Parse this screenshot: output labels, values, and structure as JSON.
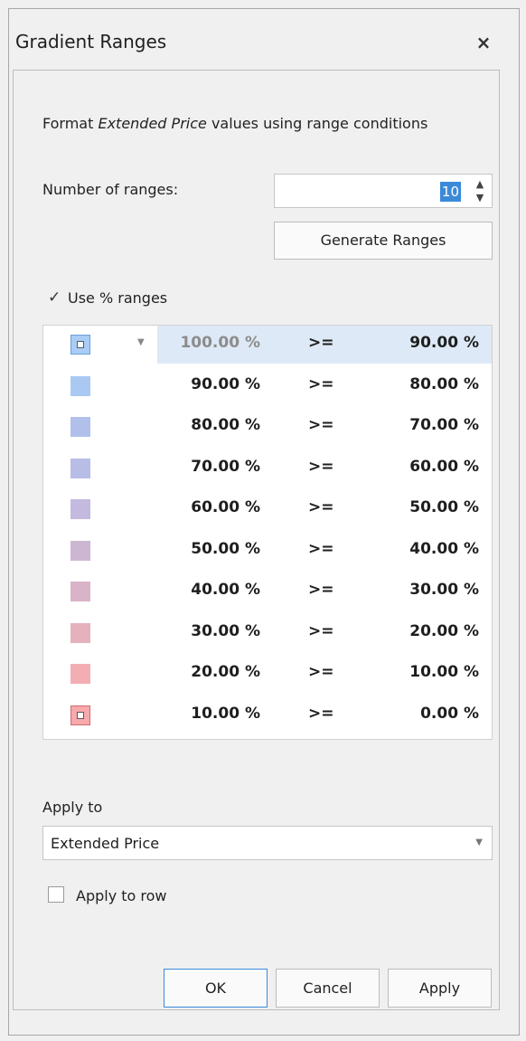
{
  "dialog": {
    "title": "Gradient Ranges",
    "close_glyph": "×"
  },
  "description": {
    "prefix": "Format ",
    "field": "Extended Price",
    "suffix": " values using range conditions"
  },
  "ranges": {
    "label": "Number of ranges:",
    "value": "10",
    "generate_label": "Generate Ranges"
  },
  "use_percent": {
    "checked": true,
    "check_glyph": "✓",
    "label": "Use % ranges"
  },
  "grid": {
    "rows": [
      {
        "color": "#a9cdf7",
        "from": "100.00 %",
        "op": ">=",
        "to": "90.00 %"
      },
      {
        "color": "#a9c9f3",
        "from": "90.00 %",
        "op": ">=",
        "to": "80.00 %"
      },
      {
        "color": "#b1c0ea",
        "from": "80.00 %",
        "op": ">=",
        "to": "70.00 %"
      },
      {
        "color": "#b8bde6",
        "from": "70.00 %",
        "op": ">=",
        "to": "60.00 %"
      },
      {
        "color": "#c4b9de",
        "from": "60.00 %",
        "op": ">=",
        "to": "50.00 %"
      },
      {
        "color": "#cdb6d2",
        "from": "50.00 %",
        "op": ">=",
        "to": "40.00 %"
      },
      {
        "color": "#d9b3c8",
        "from": "40.00 %",
        "op": ">=",
        "to": "30.00 %"
      },
      {
        "color": "#e5b1bd",
        "from": "30.00 %",
        "op": ">=",
        "to": "20.00 %"
      },
      {
        "color": "#f3aeb3",
        "from": "20.00 %",
        "op": ">=",
        "to": "10.00 %"
      },
      {
        "color": "#f7a9ac",
        "from": "10.00 %",
        "op": ">=",
        "to": "0.00 %"
      }
    ]
  },
  "apply_to": {
    "label": "Apply to",
    "value": "Extended Price",
    "arrow": "▼"
  },
  "apply_to_row": {
    "checked": false,
    "label": "Apply to row"
  },
  "buttons": {
    "ok": "OK",
    "cancel": "Cancel",
    "apply": "Apply"
  }
}
